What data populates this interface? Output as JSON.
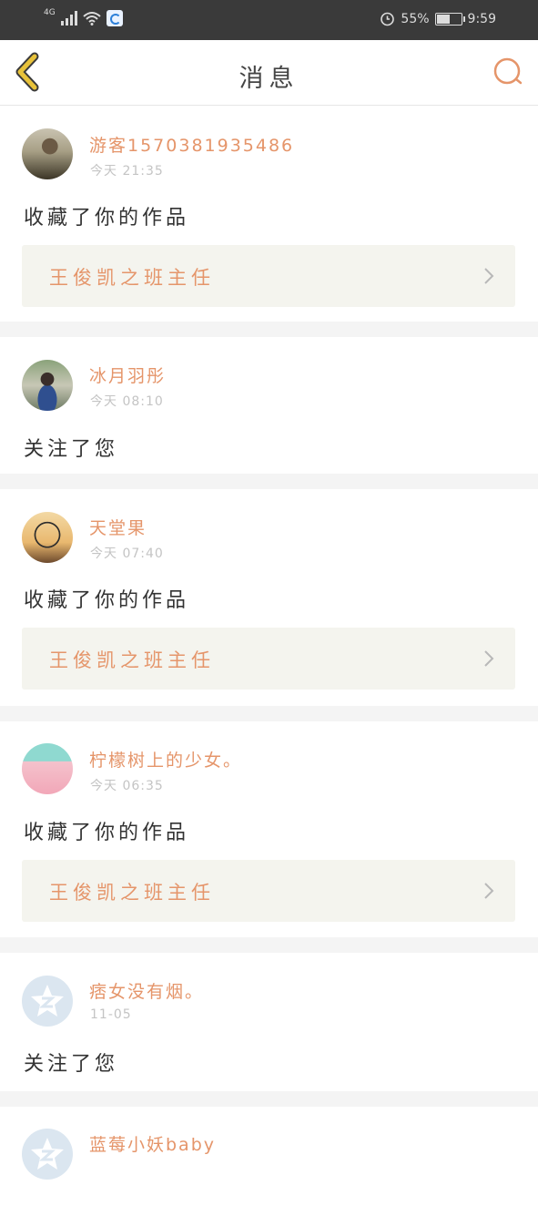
{
  "status_bar": {
    "network": "4G",
    "battery_text": "55%",
    "battery_level": 0.55,
    "time": "9:59"
  },
  "header": {
    "title": "消息",
    "back_icon": "chevron-left-icon",
    "search_icon": "search-icon"
  },
  "colors": {
    "accent": "#e5956a",
    "back_icon": "#e8c23a",
    "card_bg": "#ffffff",
    "work_bg": "#f4f4ee"
  },
  "messages": [
    {
      "user": "游客15703819354​86",
      "time": "今天 21:35",
      "action": "收藏了你的作品",
      "work": "王俊凯之班主任"
    },
    {
      "user": "冰月羽彤",
      "time": "今天 08:10",
      "action": "关注了您"
    },
    {
      "user": "天堂果",
      "time": "今天 07:40",
      "action": "收藏了你的作品",
      "work": "王俊凯之班主任"
    },
    {
      "user": "柠檬树上的少女。",
      "time": "今天 06:35",
      "action": "收藏了你的作品",
      "work": "王俊凯之班主任"
    },
    {
      "user": "痞女没有烟。",
      "time": "11-05",
      "action": "关注了您"
    },
    {
      "user": "蓝莓小妖baby"
    }
  ]
}
